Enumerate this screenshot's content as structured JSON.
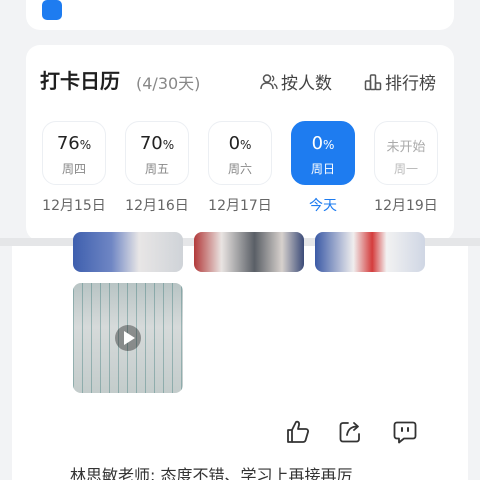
{
  "calendar": {
    "title": "打卡日历",
    "count": "(4/30天)",
    "by_person_label": "按人数",
    "leaderboard_label": "排行榜",
    "days": [
      {
        "pct": "76",
        "unit": "%",
        "week": "周四",
        "date": "12月15日"
      },
      {
        "pct": "70",
        "unit": "%",
        "week": "周五",
        "date": "12月16日"
      },
      {
        "pct": "0",
        "unit": "%",
        "week": "周六",
        "date": "12月17日"
      },
      {
        "pct": "0",
        "unit": "%",
        "week": "周日",
        "date": "今天"
      },
      {
        "pct": "未开始",
        "unit": "",
        "week": "周一",
        "date": "12月19日"
      }
    ]
  },
  "post": {
    "comment_author": "林思敏老师:",
    "comment_text": "态度不错、学习上再接再厉"
  },
  "colors": {
    "accent": "#1e7cf0",
    "background": "#f2f3f5"
  },
  "icons": {
    "like": "thumbs-up-icon",
    "share": "share-icon",
    "comment": "comment-icon"
  }
}
